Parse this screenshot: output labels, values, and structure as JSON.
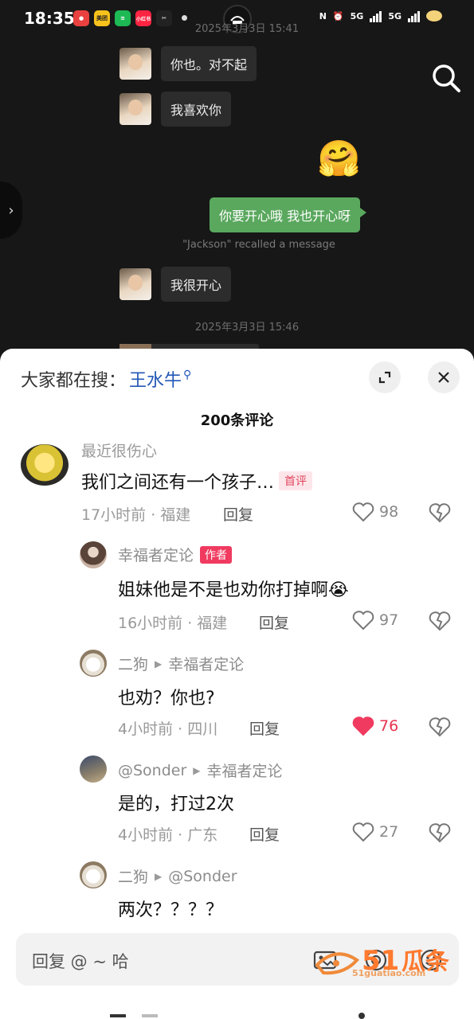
{
  "status_bar": {
    "time": "18:35",
    "apps": [
      {
        "name": "app-icon",
        "label": "",
        "color": "#e8413f"
      },
      {
        "name": "meituan-icon",
        "label": "美团",
        "color": "#f7c21c"
      },
      {
        "name": "spotify-icon",
        "label": "",
        "color": "#1db954"
      },
      {
        "name": "xiaohongshu-icon",
        "label": "小红书",
        "color": "#ff2442"
      },
      {
        "name": "capcut-icon",
        "label": "",
        "color": "#222222"
      }
    ],
    "network_1": "5G",
    "network_2": "5G"
  },
  "chat": {
    "timestamp_top": "2025年3月3日 15:41",
    "messages": [
      {
        "side": "in",
        "text": "你也。对不起"
      },
      {
        "side": "in",
        "text": "我喜欢你"
      },
      {
        "side": "out",
        "text": "🤗"
      },
      {
        "side": "out",
        "text": "你要开心哦 我也开心呀"
      },
      {
        "side": "system",
        "text": "\"Jackson\" recalled a message"
      },
      {
        "side": "in",
        "text": "我很开心"
      }
    ],
    "timestamp_bottom": "2025年3月3日 15:46"
  },
  "sheet": {
    "search_prefix": "大家都在搜：",
    "search_keyword": "王水牛",
    "comment_count": "200条评论",
    "comments": [
      {
        "username": "最近很伤心",
        "text": "我们之间还有一个孩子…",
        "tag": "首评",
        "time_loc": "17小时前 · 福建",
        "reply_label": "回复",
        "likes": "98",
        "liked": false
      },
      {
        "username": "幸福者定论",
        "tag": "作者",
        "text": "姐妹他是不是也劝你打掉啊😭",
        "time_loc": "16小时前 · 福建",
        "reply_label": "回复",
        "likes": "97",
        "liked": false
      },
      {
        "username": "二狗",
        "reply_to": "幸福者定论",
        "text": "也劝？你也?",
        "time_loc": "4小时前 · 四川",
        "reply_label": "回复",
        "likes": "76",
        "liked": true
      },
      {
        "username": "@Sonder",
        "reply_to": "幸福者定论",
        "text": "是的，打过2次",
        "time_loc": "4小时前 · 广东",
        "reply_label": "回复",
        "likes": "27",
        "liked": false
      },
      {
        "username": "二狗",
        "reply_to": "@Sonder",
        "text": "两次？？？？"
      }
    ],
    "reply_input": "回复 @ ~ 哈"
  },
  "watermark": {
    "logo": "51瓜条",
    "url": "51guatiao.com"
  },
  "colors": {
    "chat_bg": "#171717",
    "bubble_out": "#5aa85e",
    "keyword_blue": "#2358b6",
    "like_red": "#f03a5f"
  }
}
